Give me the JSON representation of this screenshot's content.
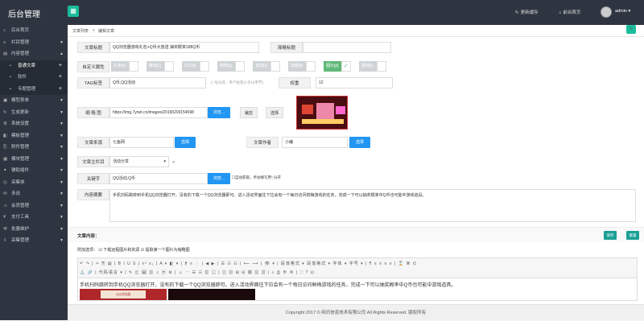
{
  "app": {
    "title": "后台管理"
  },
  "topbar": {
    "clear_cache": "更新缓存",
    "home": "前台首页",
    "user": "admin"
  },
  "sidebar": {
    "items": [
      {
        "label": "后台首页",
        "icon": "home-icon"
      },
      {
        "label": "栏目管理",
        "icon": "list-icon",
        "arrow": "▼"
      },
      {
        "label": "内容管理",
        "icon": "doc-icon",
        "arrow": "▲"
      },
      {
        "label": "普通文章",
        "icon": "",
        "active": true
      },
      {
        "label": "软件",
        "icon": ""
      },
      {
        "label": "专题管理",
        "icon": ""
      },
      {
        "label": "模型表单",
        "icon": "form-icon",
        "arrow": "▼"
      },
      {
        "label": "生成更新",
        "icon": "refresh-icon",
        "arrow": "▼"
      },
      {
        "label": "系统设置",
        "icon": "gear-icon",
        "arrow": "▼"
      },
      {
        "label": "模板管理",
        "icon": "template-icon",
        "arrow": "▼"
      },
      {
        "label": "附件管理",
        "icon": "attach-icon",
        "arrow": "▼"
      },
      {
        "label": "模块管理",
        "icon": "module-icon",
        "arrow": "▼"
      },
      {
        "label": "辅助插件",
        "icon": "plugin-icon",
        "arrow": "▼"
      },
      {
        "label": "采集侠",
        "icon": "collect-icon",
        "arrow": "▼"
      },
      {
        "label": "多说",
        "icon": "chat-icon",
        "arrow": "▼"
      },
      {
        "label": "会员管理",
        "icon": "user-icon",
        "arrow": "▼"
      },
      {
        "label": "支付工具",
        "icon": "pay-icon",
        "arrow": "▼"
      },
      {
        "label": "批量维护",
        "icon": "batch-icon",
        "arrow": "▼"
      },
      {
        "label": "采集管理",
        "icon": "gather-icon",
        "arrow": "▼"
      }
    ]
  },
  "breadcrumb": {
    "item1": "文章列表",
    "sep": "»",
    "item2": "编辑文章"
  },
  "form": {
    "title_label": "文章标题",
    "title_value": "QQ浏览器游戏礼包+Q币大放送 抽奖概率188Q币",
    "short_title_label": "简略标题",
    "short_title_value": "",
    "attr_label": "自定义属性",
    "attrs": [
      "头条[h]",
      "推荐[c]",
      "幻灯[f]",
      "特荐[a]",
      "滚动[s]",
      "加粗[b]",
      "图片[p]",
      "跳转[j]"
    ],
    "tag_label": "TAG标签",
    "tag_value": "Q币,QQ活动",
    "tag_hint": "(','号分开，单个标签小于12字节)",
    "weight_label": "权重",
    "weight_value": "12",
    "thumb_label": "缩 略 图",
    "thumb_value": "https://img.7ynet.cn/images/2019020l/154598",
    "browse": "浏览...",
    "crop": "裁剪",
    "select": "选择",
    "source_label": "文章来源",
    "source_value": "七鱼网",
    "author_label": "文章作者",
    "author_value": "小编",
    "column_label": "文章主栏目",
    "column_value": "活动分享",
    "keywords_label": "关键字",
    "keywords_value": "QQ活动,Q币",
    "auto_fetch": "自动获取，手动填写用','分开",
    "desc_label": "内容摘要",
    "desc_value": "手机扫码跳转到手机QQ浏览器打开，没有的下载一个QQ浏览器即可。进入活动界面往下拉会有一个每日访问鲜梅游戏的任务，完成一下可以抽奖概率中Q币也可能中游戏道具。"
  },
  "content": {
    "label": "文章内容：",
    "save": "保存",
    "reset": "重置",
    "options_label": "附加选项：",
    "opt1": "下载远程图片和资源",
    "opt2": "提取第一个图片为缩略图",
    "tb_row1": "↶ ↷ | ✂ ⎘ ▤ | B I U S | x² x₂ | A ▾ ◧ ▾ | ⁋ ≡ ⋮ | ◀ ▶ | ☰ ☷ ☷ | ⟵ ⟶ | 👁 ▾ | 段落格式 ▾  段落格式 ▾  字体 ▾  字号 ▾ | ¶ ≡ ≡ ≡ ≡ | ⌛ ⌘ ⌬",
    "tb_row2": "⚓ 🔗 | 代码语言 ▾ | ✎ ◫ 🖼 ▦ ♫ ▣ ⚙ | ☺ ⋯ ☰ ☷ ▦ ▤ | ▥ ▧ ⊞ ⊟ ▩ ▨ ▦ | ⌕ ⎙ ⊕ ⊗ | ⛶ ? ⊡",
    "body_text": "手机扫码跳转到手机QQ浏览器打开，没有的下载一个QQ浏览器即可。进入活动界面往下拉会有一个每日访问鲜梅游戏的任务，完成一下可以抽奖概率中Q币也可能中游戏道具。",
    "img_caption": "QQ浏览器"
  },
  "footer": {
    "copyright": "Copyright 2017 © 网讯信息技术有限公司 All Rights Reserved. 版权所有"
  },
  "colors": {
    "accent": "#1abc9c",
    "sidebar": "#2e3540",
    "blue": "#2196f3",
    "green": "#1aa094"
  }
}
